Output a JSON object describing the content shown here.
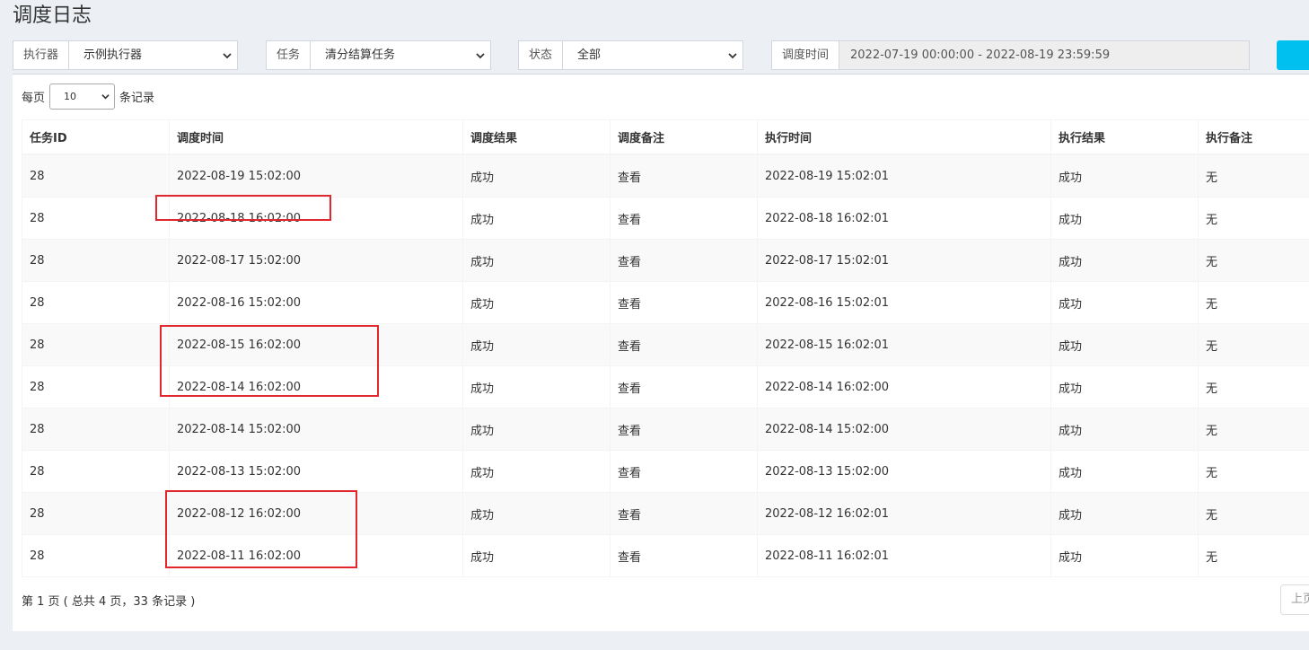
{
  "page_title": "调度日志",
  "filters": {
    "executor": {
      "label": "执行器",
      "value": "示例执行器"
    },
    "job": {
      "label": "任务",
      "value": "清分结算任务"
    },
    "status": {
      "label": "状态",
      "value": "全部"
    },
    "time": {
      "label": "调度时间",
      "value": "2022-07-19 00:00:00 - 2022-08-19 23:59:59"
    }
  },
  "length_menu": {
    "prefix": "每页",
    "value": "10",
    "suffix": "条记录"
  },
  "columns": [
    "任务ID",
    "调度时间",
    "调度结果",
    "调度备注",
    "执行时间",
    "执行结果",
    "执行备注"
  ],
  "rows": [
    {
      "job_id": "28",
      "trigger_time": "2022-08-19 15:02:00",
      "trigger_result": "成功",
      "trigger_msg": "查看",
      "handle_time": "2022-08-19 15:02:01",
      "handle_result": "成功",
      "handle_msg": "无"
    },
    {
      "job_id": "28",
      "trigger_time": "2022-08-18 16:02:00",
      "trigger_result": "成功",
      "trigger_msg": "查看",
      "handle_time": "2022-08-18 16:02:01",
      "handle_result": "成功",
      "handle_msg": "无"
    },
    {
      "job_id": "28",
      "trigger_time": "2022-08-17 15:02:00",
      "trigger_result": "成功",
      "trigger_msg": "查看",
      "handle_time": "2022-08-17 15:02:01",
      "handle_result": "成功",
      "handle_msg": "无"
    },
    {
      "job_id": "28",
      "trigger_time": "2022-08-16 15:02:00",
      "trigger_result": "成功",
      "trigger_msg": "查看",
      "handle_time": "2022-08-16 15:02:01",
      "handle_result": "成功",
      "handle_msg": "无"
    },
    {
      "job_id": "28",
      "trigger_time": "2022-08-15 16:02:00",
      "trigger_result": "成功",
      "trigger_msg": "查看",
      "handle_time": "2022-08-15 16:02:01",
      "handle_result": "成功",
      "handle_msg": "无"
    },
    {
      "job_id": "28",
      "trigger_time": "2022-08-14 16:02:00",
      "trigger_result": "成功",
      "trigger_msg": "查看",
      "handle_time": "2022-08-14 16:02:00",
      "handle_result": "成功",
      "handle_msg": "无"
    },
    {
      "job_id": "28",
      "trigger_time": "2022-08-14 15:02:00",
      "trigger_result": "成功",
      "trigger_msg": "查看",
      "handle_time": "2022-08-14 15:02:00",
      "handle_result": "成功",
      "handle_msg": "无"
    },
    {
      "job_id": "28",
      "trigger_time": "2022-08-13 15:02:00",
      "trigger_result": "成功",
      "trigger_msg": "查看",
      "handle_time": "2022-08-13 15:02:00",
      "handle_result": "成功",
      "handle_msg": "无"
    },
    {
      "job_id": "28",
      "trigger_time": "2022-08-12 16:02:00",
      "trigger_result": "成功",
      "trigger_msg": "查看",
      "handle_time": "2022-08-12 16:02:01",
      "handle_result": "成功",
      "handle_msg": "无"
    },
    {
      "job_id": "28",
      "trigger_time": "2022-08-11 16:02:00",
      "trigger_result": "成功",
      "trigger_msg": "查看",
      "handle_time": "2022-08-11 16:02:01",
      "handle_result": "成功",
      "handle_msg": "无"
    }
  ],
  "pagination": {
    "info": "第 1 页 ( 总共 4 页，33 条记录 )",
    "prev_label": "上页"
  },
  "colors": {
    "link": "#3c8dbc",
    "success": "#008d4c",
    "search_button": "#00c0ef",
    "annotation": "#e0282e"
  }
}
